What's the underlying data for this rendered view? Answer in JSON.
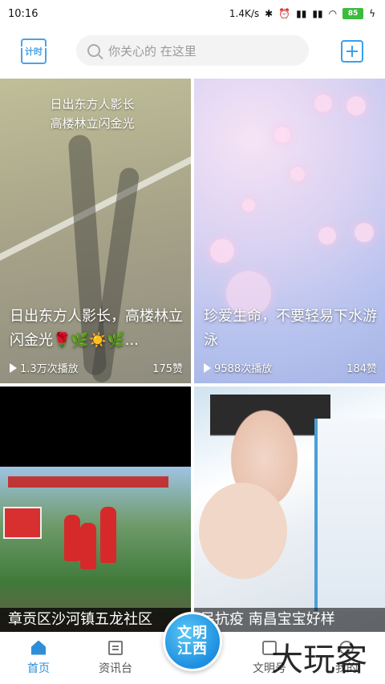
{
  "status_bar": {
    "time": "10:16",
    "net_speed": "1.4K/s",
    "battery": "85"
  },
  "header": {
    "scan_label": "计时",
    "search_placeholder": "你关心的 在这里"
  },
  "feed": [
    {
      "overlay_line1": "日出东方人影长",
      "overlay_line2": "高楼林立闪金光",
      "title": "日出东方人影长，高楼林立闪金光🌹🌿☀️🌿...",
      "plays": "1.3万次播放",
      "likes": "175赞"
    },
    {
      "title": "珍爱生命，不要轻易下水游泳",
      "plays": "9588次播放",
      "likes": "184赞"
    },
    {
      "caption": "章贡区沙河镇五龙社区"
    },
    {
      "caption": "民抗疫 南昌宝宝好样"
    }
  ],
  "nav": {
    "home": "首页",
    "news": "资讯台",
    "center_line1": "文明",
    "center_line2": "江西",
    "wenming": "文明号",
    "me": "我的"
  },
  "watermark": "大玩客",
  "colors": {
    "accent": "#2e8fd8",
    "battery": "#3dbb3d"
  }
}
